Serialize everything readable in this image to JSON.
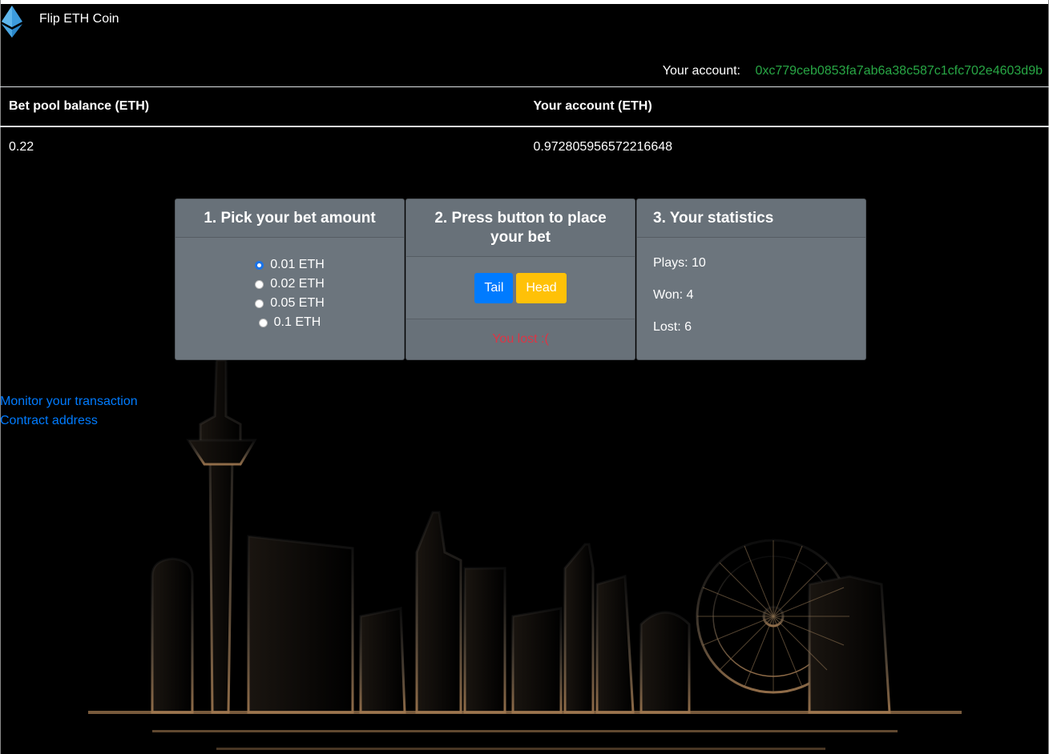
{
  "navbar": {
    "title": "Flip ETH Coin",
    "logo_icon": "ethereum-logo-icon"
  },
  "account": {
    "label": "Your account:",
    "address": "0xc779ceb0853fa7ab6a38c587c1cfc702e4603d9b"
  },
  "balances": {
    "headers": [
      "Bet pool balance (ETH)",
      "Your account (ETH)"
    ],
    "values": [
      "0.22",
      "0.972805956572216648"
    ]
  },
  "bet_card": {
    "title": "1. Pick your bet amount",
    "options": [
      "0.01 ETH",
      "0.02 ETH",
      "0.05 ETH",
      "0.1 ETH"
    ],
    "selected": "0.01 ETH"
  },
  "action_card": {
    "title": "2. Press button to place your bet",
    "tail_label": "Tail",
    "head_label": "Head",
    "result": "You lost :("
  },
  "stats_card": {
    "title": "3. Your statistics",
    "plays": "Plays: 10",
    "won": "Won: 4",
    "lost": "Lost: 6"
  },
  "links": {
    "monitor": "Monitor your transaction",
    "contract": "Contract address"
  },
  "colors": {
    "accent_blue": "#007bff",
    "head_yellow": "#ffc107",
    "address_green": "#28a745",
    "lost_red": "#dc3545",
    "card_gray": "#6c757d"
  }
}
